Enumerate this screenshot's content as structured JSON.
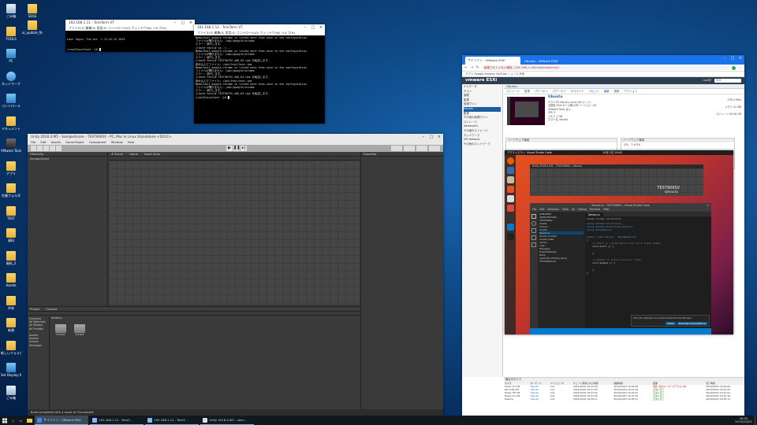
{
  "desktop": {
    "icons": [
      {
        "label": "ごみ箱",
        "kind": "bin"
      },
      {
        "label": "TOOLS",
        "kind": "folder"
      },
      {
        "label": "PC",
        "kind": "pc"
      },
      {
        "label": "ネットワーク",
        "kind": "net"
      },
      {
        "label": "コントロール",
        "kind": "pc"
      },
      {
        "label": "ドキュメント",
        "kind": "folder"
      },
      {
        "label": "VMware Tools",
        "kind": "app"
      },
      {
        "label": "アプリ",
        "kind": "folder"
      },
      {
        "label": "作業フォルダ",
        "kind": "folder"
      },
      {
        "label": "TEST",
        "kind": "folder"
      },
      {
        "label": "資料",
        "kind": "folder"
      },
      {
        "label": "資料_2",
        "kind": "folder"
      },
      {
        "label": "Assets",
        "kind": "folder"
      },
      {
        "label": "共有",
        "kind": "folder"
      },
      {
        "label": "新規",
        "kind": "folder"
      },
      {
        "label": "新しいフォルダー",
        "kind": "folder"
      },
      {
        "label": "Set Display Manager",
        "kind": "pc"
      },
      {
        "label": "ごみ箱",
        "kind": "bin"
      }
    ],
    "icons2": [
      {
        "label": "SDSS",
        "kind": "folder"
      },
      {
        "label": "ai_update_files",
        "kind": "folder"
      }
    ]
  },
  "terminal1": {
    "title": "192.168.1.11 - TeraTerm VT",
    "menu": "ファイル(F)  編集(E)  設定(S)  コントロール(O)  ウィンドウ(W)  ヘルプ(H)",
    "lines": [
      "Last login: Tue Oct  1 17:41:12 2019",
      "[root@localhost ~]# █"
    ]
  },
  "terminal2": {
    "title": "192.168.1.12 - TeraTerm VT",
    "menu": "ファイル(F)  編集(E)  設定(S)  コントロール(O)  ウィンドウ(W)  ヘルプ(H)",
    "lines": [
      "Nemo/host google-chrome is listed more than once in the configuration",
      "ファイルが開けません: /opt/google/chrome",
      "エラー: 続行します。",
      "[root@ test]# cp -r...",
      "Nemo/host google-chrome is listed more than once in the configuration",
      "ファイルが開けません: /opt/google/chrome",
      "エラー: 続行します。",
      "[root@ test]# TEST907SV_x86_64.rpm を転送します。",
      "読み込んだファイル: /opt/test/test.rpm",
      "Nemo/host google-chrome is listed more than once in the configuration",
      "ファイルが開けません: /opt/google/chrome",
      "エラー: 続行します。",
      "[root@ test]# TEST907SV_x86_64.rpm を転送します。",
      "読み込んだファイル: /opt/test/test.rpm",
      "Nemo/host google-chrome is listed more than once in the configuration",
      "ファイルが開けません: /opt/google/chrome",
      "エラー: 続行します。",
      "[root@ test]# TEST907SV_x86_64.rpm を転送します。",
      "[root@localhost ~]# █"
    ]
  },
  "unity": {
    "title": "Unity 2018.4.9f1 - SampleScene - TEST906SV - PC, Mac & Linux Standalone <DX11>",
    "menu": [
      "File",
      "Edit",
      "Assets",
      "GameObject",
      "Component",
      "Window",
      "Help"
    ],
    "hierarchy_label": "Hierarchy",
    "hierarchy_item": "SampleScene",
    "scene_tabs": [
      "# Scene",
      "Game",
      "Asset Store"
    ],
    "inspector_label": "Inspector",
    "project_tabs": [
      "Project",
      "Console"
    ],
    "favorites": [
      "Favorites",
      "All Materials",
      "All Models",
      "All Prefabs"
    ],
    "assets_tree": [
      "Assets",
      "Scenes",
      "Scripts",
      "Packages"
    ],
    "breadcrumb": "Assets ▸",
    "assets_files": [
      "Scenes",
      "Scripts"
    ],
    "status": "Build completed with a result of 'Succeeded'"
  },
  "browser": {
    "tabs": [
      "サインイン - VMware ESXi",
      "Ubuntu - VMware ESXi"
    ],
    "url": "保護されていない通信 | 192.168.1.100/ui/#/host/vms/1",
    "bookmarks": "アプリ  Google  Amazon  YouTube  ニュース  天気",
    "brand": "vmware ESXi",
    "user": "root@",
    "search_placeholder": "検索",
    "nav": [
      "ナビゲータ",
      "ホスト",
      "管理",
      "監視",
      "仮想マシン",
      "Ubuntu",
      "監視",
      "その他の仮想マシン",
      "ストレージ",
      "datastore1",
      "その他のストレージ",
      "ネットワーク",
      "VM Network",
      "その他のネットワーク"
    ],
    "vm_name": "Ubuntu",
    "toolbar": [
      "コンソール",
      "監視",
      "パワーオン",
      "パワーオフ",
      "サスペンド",
      "リセット",
      "編集",
      "更新",
      "アクション"
    ],
    "vm_info": [
      "ゲストOS  Ubuntu Linux (64 ビット)",
      "互換性  ESXi 6.7 以降 (VM バージョン 14)",
      "VMware Tools  はい",
      "CPU  2",
      "メモリ  4 GB",
      "ホスト名  ubuntu"
    ],
    "vm_stats": [
      "CPU 0 MHz",
      "メモリ 41 MB",
      "ストレージ 20.56 GB"
    ],
    "section_hw": "ハードウェア構成",
    "section_hw2": "ハードウェア構成",
    "section_cpu": "CPU",
    "cpu_val": "2 vCPU",
    "tasks_header": "最近のタスク",
    "tasks_cols": [
      "タスク",
      "ターゲット",
      "イニシエータ",
      "キューに登録された時間",
      "開始時間",
      "結果",
      "完了時間"
    ],
    "tasks": [
      {
        "task": "Power On VM",
        "target": "Ubuntu",
        "init": "root",
        "queued": "2019/10/01 16:42:09",
        "start": "2019/10/01 16:42:09",
        "result": "問題: 他のユーザーがアクセス中",
        "done": "2019/10/01 16:42:09",
        "ok": false
      },
      {
        "task": "Reconfig VM",
        "target": "Ubuntu",
        "init": "root",
        "queued": "2019/10/01 16:41:59",
        "start": "2019/10/01 16:41:59",
        "result": "正常に完了",
        "done": "2019/10/01 16:41:59",
        "ok": true
      },
      {
        "task": "Power Off VM",
        "target": "Ubuntu",
        "init": "root",
        "queued": "2019/10/01 16:41:52",
        "start": "2019/10/01 16:41:52",
        "result": "正常に完了",
        "done": "2019/10/01 16:41:52",
        "ok": true
      },
      {
        "task": "Power On VM",
        "target": "Ubuntu",
        "init": "root",
        "queued": "2019/10/01 16:37:30",
        "start": "2019/10/01 16:37:30",
        "result": "正常に完了",
        "done": "2019/10/01 16:37:30",
        "ok": true
      },
      {
        "task": "Destroy",
        "target": "Ubuntu",
        "init": "root",
        "queued": "2019/10/01 16:30:11",
        "start": "2019/10/01 16:30:11",
        "result": "正常に完了",
        "done": "2019/10/01 16:30:11",
        "ok": true
      }
    ]
  },
  "ubuntu": {
    "topbar_left": "アクティビティ",
    "topbar_app": "Visual Studio Code",
    "topbar_time": "10月 1日 16:42",
    "unity_title": "Unity 2018.4.9f1 - TEST906SV - Ubuntu",
    "unity_text": "TEST906SV",
    "unity_subtext": "SERVICES",
    "vscode_title": "Server.cs - TEST906SV - Visual Studio Code",
    "vscode_menu": [
      "File",
      "Edit",
      "Selection",
      "View",
      "Go",
      "Debug",
      "Terminal",
      "Help"
    ],
    "explorer_label": "EXPLORER",
    "explorer_items": [
      "OPEN EDITORS",
      "TEST906SV",
      "Assets",
      "Scenes",
      "Scripts",
      "Server.cs",
      "Server.cs.meta",
      "Scripts.meta",
      "Library",
      "Logs",
      "Packages",
      "ProjectSettings",
      "Temp",
      "Assembly-CSharp.csproj",
      "TEST906SV.sln"
    ],
    "tab": "Server.cs",
    "breadcrumb": "Assets › Scripts › C# Server.cs",
    "code": [
      "using System.Collections;",
      "using System.Collections.Generic;",
      "using UnityEngine;",
      "",
      "public class Server : MonoBehaviour",
      "{",
      "    // Start is called before the first frame update",
      "    void Start () {",
      "",
      "    }",
      "",
      "    // Update is called once per frame",
      "    void Update () {",
      "",
      "    }",
      "}"
    ],
    "notification": "The 'C#' extension is recommended for this file type.",
    "notif_btn1": "Install",
    "notif_btn2": "Show Recommendations"
  },
  "taskbar": {
    "apps": [
      {
        "label": "サインイン - VMware ESXi",
        "color": "#4285f4"
      },
      {
        "label": "192.168.1.11 - TeraT...",
        "color": "#8ab4f8"
      },
      {
        "label": "192.168.1.12 - TeraT...",
        "color": "#8ab4f8"
      },
      {
        "label": "Unity 2018.4.9f1 - sam...",
        "color": "#dddddd"
      }
    ],
    "time": "16:42",
    "date": "2019/10/01"
  }
}
